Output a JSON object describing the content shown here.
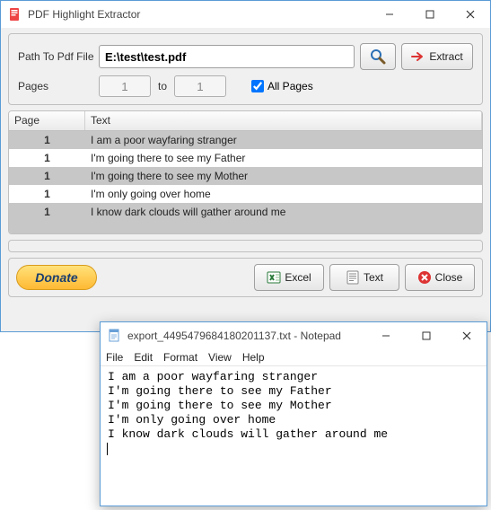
{
  "mainWindow": {
    "title": "PDF Highlight Extractor",
    "pathLabel": "Path To Pdf File",
    "pathValue": "E:\\test\\test.pdf",
    "extractLabel": "Extract",
    "pagesLabel": "Pages",
    "pageFrom": "1",
    "toLabel": "to",
    "pageTo": "1",
    "allPagesLabel": "All Pages",
    "table": {
      "headerPage": "Page",
      "headerText": "Text",
      "rows": [
        {
          "page": "1",
          "text": "I am a poor wayfaring stranger"
        },
        {
          "page": "1",
          "text": "I'm going there to see my Father"
        },
        {
          "page": "1",
          "text": "I'm going there to see my Mother"
        },
        {
          "page": "1",
          "text": "I'm only going over home"
        },
        {
          "page": "1",
          "text": "I know dark clouds will gather around me"
        }
      ]
    },
    "donateLabel": "Donate",
    "excelLabel": "Excel",
    "textLabel": "Text",
    "closeLabel": "Close"
  },
  "notepad": {
    "title": "export_4495479684180201137.txt - Notepad",
    "menu": {
      "file": "File",
      "edit": "Edit",
      "format": "Format",
      "view": "View",
      "help": "Help"
    },
    "content": "I am a poor wayfaring stranger\nI'm going there to see my Father\nI'm going there to see my Mother\nI'm only going over home\nI know dark clouds will gather around me\n"
  }
}
